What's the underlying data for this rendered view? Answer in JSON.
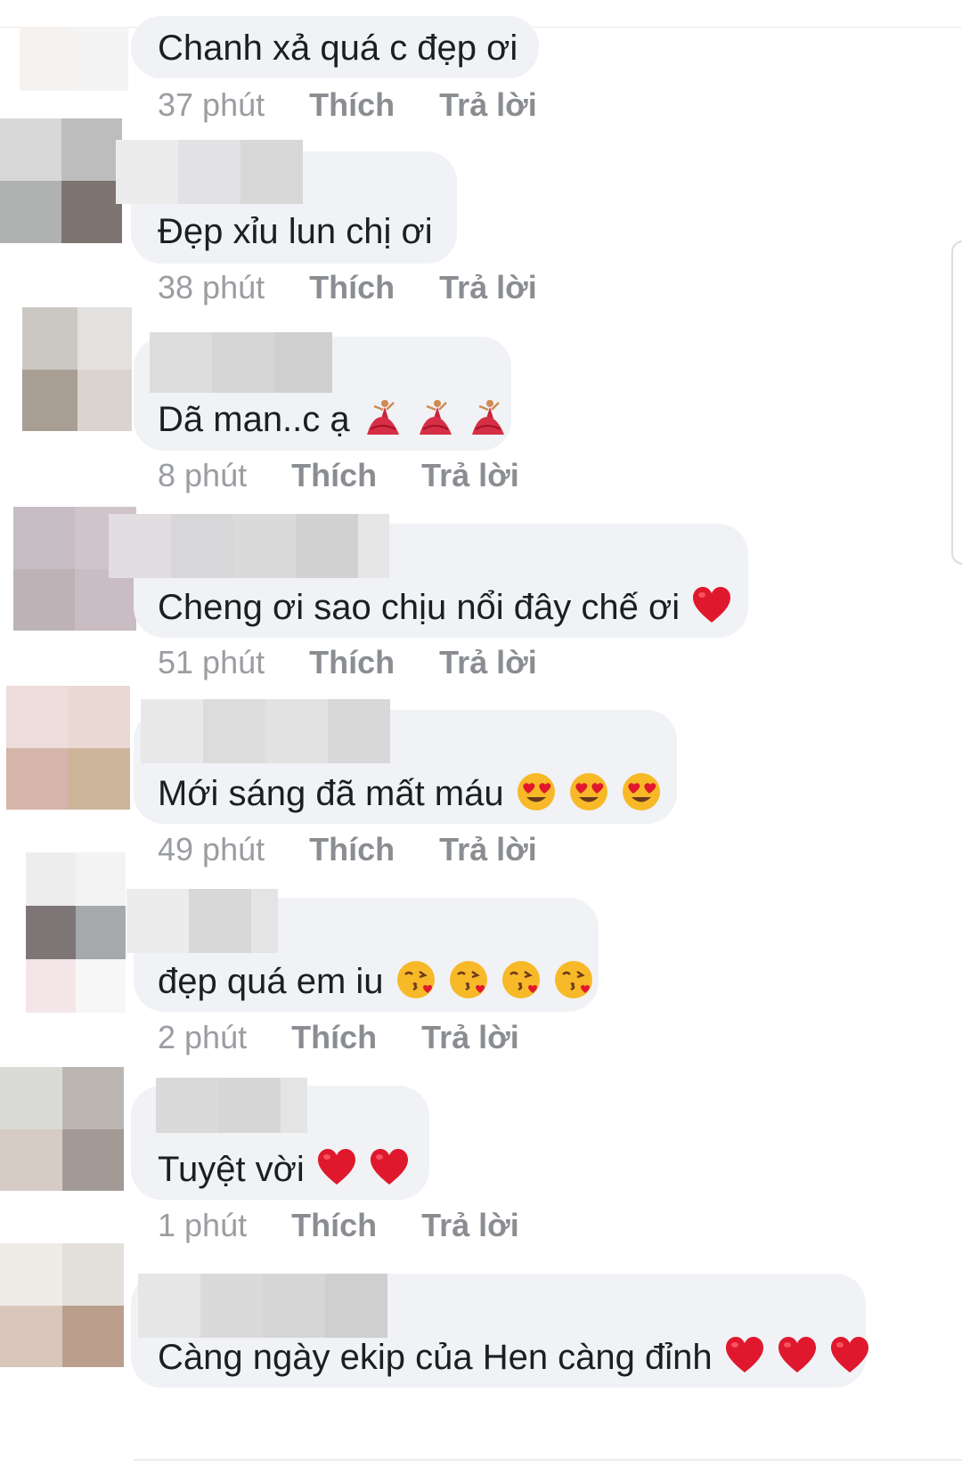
{
  "actions": {
    "like": "Thích",
    "reply": "Trả lời"
  },
  "comments": [
    {
      "text": "Chanh xả quá c đẹp ơi",
      "time": "37 phút",
      "emojis": [],
      "avatar_colors": [
        "#f6f2f0",
        "#f4f4f4",
        "#f2eeee",
        "#f4f4f4"
      ],
      "name_colors": []
    },
    {
      "text": "Đẹp xỉu lun chị ơi",
      "time": "38 phút",
      "emojis": [],
      "avatar_colors": [
        "#d7d7d7",
        "#bdbdbd",
        "#b0b2b1",
        "#7d7370"
      ],
      "name_colors": [
        "#ececec",
        "#e2e2e4",
        "#d8d8d8"
      ]
    },
    {
      "text": "Dã man..c ạ",
      "time": "8 phút",
      "emojis": [
        "dancer-icon",
        "dancer-icon",
        "dancer-icon"
      ],
      "avatar_colors": [
        "#cbc8c3",
        "#e3e1df",
        "#a89e94",
        "#d9d4cf"
      ],
      "name_colors": [
        "#dddddd",
        "#d6d6d6",
        "#d0d0d0"
      ]
    },
    {
      "text": "Cheng ơi sao chịu nổi đây chế ơi",
      "time": "51 phút",
      "emojis": [
        "red-heart-icon"
      ],
      "avatar_colors": [
        "#c7bdc5",
        "#d0c3ca",
        "#bdb2b5",
        "#c9bcc2"
      ],
      "name_colors": [
        "#e2dde0",
        "#d7d7d9",
        "#dadada",
        "#d2d2d2",
        "#e6e6e6"
      ]
    },
    {
      "text": "Mới sáng đã mất máu",
      "time": "49 phút",
      "emojis": [
        "heart-eyes-icon",
        "heart-eyes-icon",
        "heart-eyes-icon"
      ],
      "avatar_colors": [
        "#eddcd9",
        "#e9d8d3",
        "#d5b4aa",
        "#cdb59a"
      ],
      "name_colors": [
        "#e8e8e8",
        "#dcdcdc",
        "#e2e2e2",
        "#d8d8d8"
      ]
    },
    {
      "text": "đẹp quá em iu",
      "time": "2 phút",
      "emojis": [
        "kissing-heart-icon",
        "kissing-heart-icon",
        "kissing-heart-icon",
        "kissing-heart-icon"
      ],
      "avatar_colors": [
        "#ededed",
        "#f3f3f3",
        "#7d7576",
        "#a6a9ab",
        "#f4e6e8",
        "#f7f7f7"
      ],
      "name_colors": [
        "#ececec",
        "#d8d8d8",
        "#e4e4e4"
      ]
    },
    {
      "text": "Tuyệt vời",
      "time": "1 phút",
      "emojis": [
        "red-heart-icon",
        "red-heart-icon"
      ],
      "avatar_colors": [
        "#dadad6",
        "#bcb6b2",
        "#d6ccc5",
        "#a39a96"
      ],
      "name_colors": [
        "#dadada",
        "#d6d6d6",
        "#e4e4e4"
      ]
    },
    {
      "text": "Càng ngày ekip của Hen càng đỉnh",
      "time": "",
      "emojis": [
        "red-heart-icon",
        "red-heart-icon",
        "red-heart-icon"
      ],
      "avatar_colors": [
        "#efebe7",
        "#e3e0dc",
        "#d8c6bb",
        "#bb9f8c"
      ],
      "name_colors": [
        "#e6e6e6",
        "#dadada",
        "#d6d6d6",
        "#cfcfcf"
      ]
    }
  ]
}
